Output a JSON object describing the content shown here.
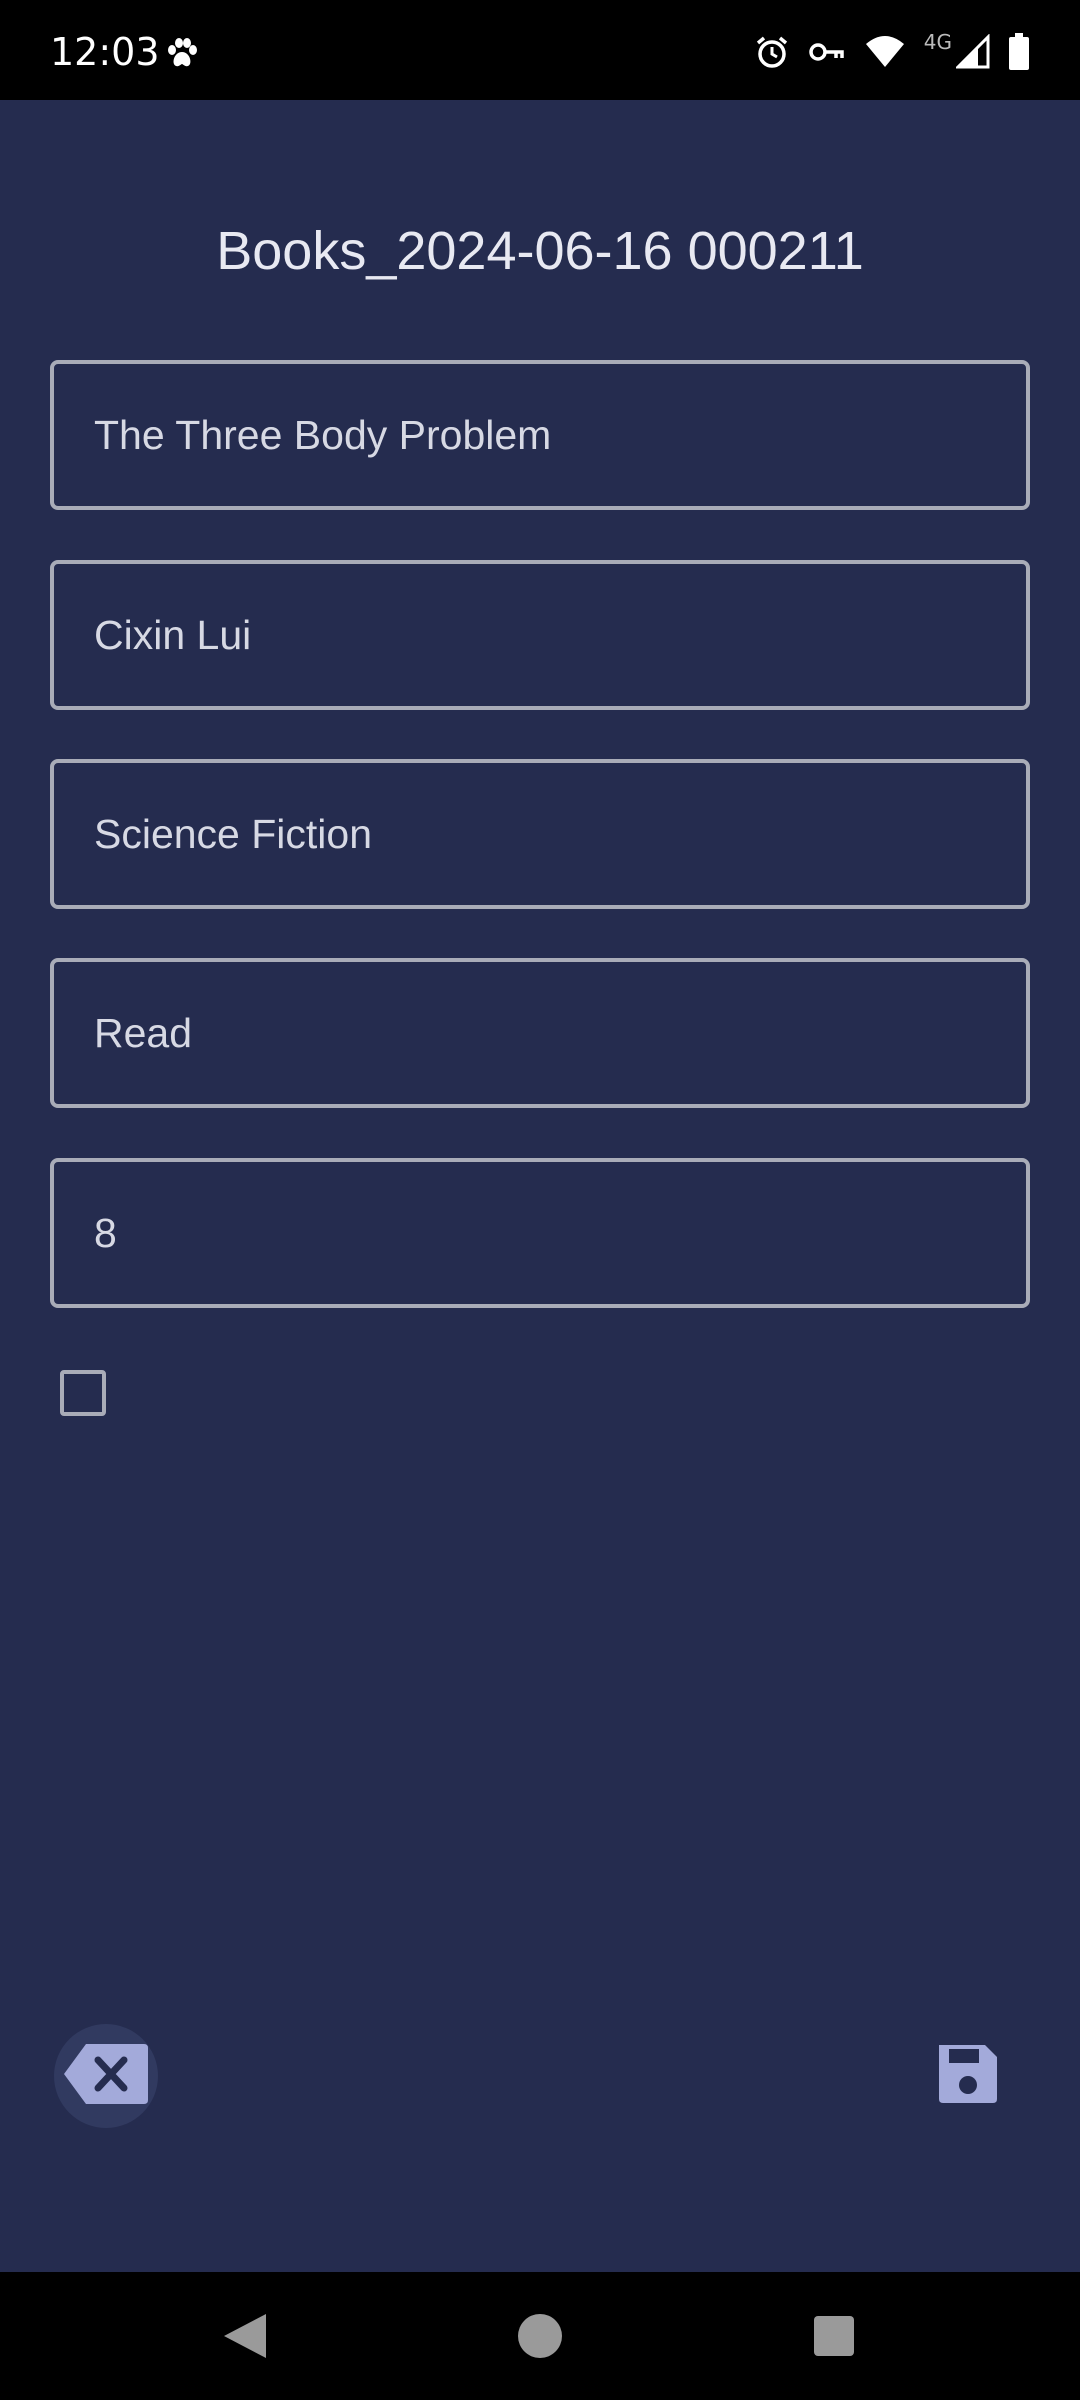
{
  "status_bar": {
    "time": "12:03",
    "network_label": "4G",
    "icons": [
      "paw-icon",
      "alarm-icon",
      "vpn-key-icon",
      "wifi-icon",
      "signal-icon",
      "battery-icon"
    ]
  },
  "form": {
    "title": "Books_2024-06-16 000211",
    "fields": [
      {
        "name": "title",
        "value": "The Three Body Problem"
      },
      {
        "name": "author",
        "value": "Cixin Lui"
      },
      {
        "name": "genre",
        "value": "Science Fiction"
      },
      {
        "name": "status",
        "value": "Read"
      },
      {
        "name": "rating",
        "value": "8"
      }
    ],
    "checkbox_checked": false
  },
  "actions": {
    "clear_icon": "backspace-clear-icon",
    "save_icon": "save-floppy-icon"
  },
  "navigation": {
    "icons": [
      "back-icon",
      "home-icon",
      "recents-icon"
    ]
  },
  "colors": {
    "background": "#252c4f",
    "field_border": "#a9acb8",
    "accent_icon": "#a3aada",
    "text": "#d7d9e4"
  }
}
